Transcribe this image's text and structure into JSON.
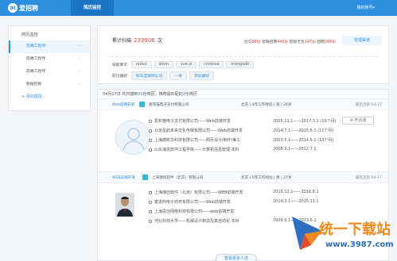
{
  "topbar": {
    "logo_glyph": "ai",
    "logo_text": "爱招聘",
    "active_nav": "简历监控",
    "account": "我的账号▾"
  },
  "sidebar": {
    "title": "简历监控",
    "items": [
      {
        "label": "前端工程师",
        "dots": "···"
      },
      {
        "label": "前端工程师",
        "dots": "···"
      },
      {
        "label": "前端工程师",
        "dots": "···"
      },
      {
        "label": "数据挖掘",
        "dots": "···"
      }
    ],
    "add_label": "+ 添加监控"
  },
  "summary": {
    "total_prefix": "累计扫描",
    "total_value": "233006",
    "total_suffix": "次",
    "stats": [
      {
        "label": "拉勾",
        "value": "98份"
      },
      {
        "label": "智联招聘",
        "value": "446份"
      },
      {
        "label": "前程无忧",
        "value": "147份"
      },
      {
        "label": "猎聘",
        "value": "266份"
      }
    ],
    "manage_label": "管理渠道",
    "skills_label": "技能要求:",
    "skills": [
      "redux",
      "atom",
      "vue.js",
      "cordova",
      "mongodb"
    ],
    "company_label": "职位偏好:",
    "companies": [
      "和车互联网公司",
      "一条"
    ],
    "add_company": "添加偏好"
  },
  "feed": {
    "header_prefix": "04月17日 共扫描到",
    "header_count": "93",
    "header_mid": "份简历，推荐最匹配的",
    "header_top": "2",
    "header_suffix": "份简历",
    "jobs": [
      {
        "title": "Web前端开发",
        "company": "爱和猫电子支付有限公司",
        "city": "北京",
        "years": "4年工作经验",
        "gender": "男",
        "age": "26岁",
        "updated": "最后活跃:04-17",
        "dislike": "不合适",
        "experiences": [
          {
            "text": "爱和猫电子支付有限公司——Web前端开发",
            "date": "2015.11.1——2017.3.1 (16个月)"
          },
          {
            "text": "北京星航未来文化传媒有限公司——Web前端开发",
            "date": "2014.7.1——2015.6.1 (11个月)"
          },
          {
            "text": "上海德新华科技有限公司——网页设计/制作/美工",
            "date": "2013.5.1——2014.6.1 (13个月)"
          },
          {
            "text": "山东海天软件工程学院——计算机信息管理 本科",
            "date": "2008.9.1——2012.7.1"
          }
        ]
      },
      {
        "title": "WEB前端开发",
        "company": "上海瑞创软件（北京）有限公司",
        "city": "北京",
        "years": "5年工作经验",
        "gender": "男",
        "age": "27岁",
        "updated": "最后活跃:04-17",
        "experiences": [
          {
            "text": "上海瑞创软件（北京）有限公司——WEB前端开发",
            "date": "2015.12.1——2016.8.1"
          },
          {
            "text": "富道商电子商务有限公司——Web前端开发",
            "date": "2014.3.1——2015.11.1"
          },
          {
            "text": "上海思创网络科技有限公司——web前端开发",
            "date": ""
          },
          {
            "text": "河北科技大学——机械设计制造及其自动化 本科",
            "date": "2009.9.1——2013.6.1"
          }
        ]
      }
    ],
    "more_label": "查看更多人选"
  },
  "watermark": {
    "line1": "统一下载站",
    "line2": "www.3987.com"
  },
  "colors": {
    "primary": "#2d8fe0",
    "accent_red": "#e34040"
  }
}
